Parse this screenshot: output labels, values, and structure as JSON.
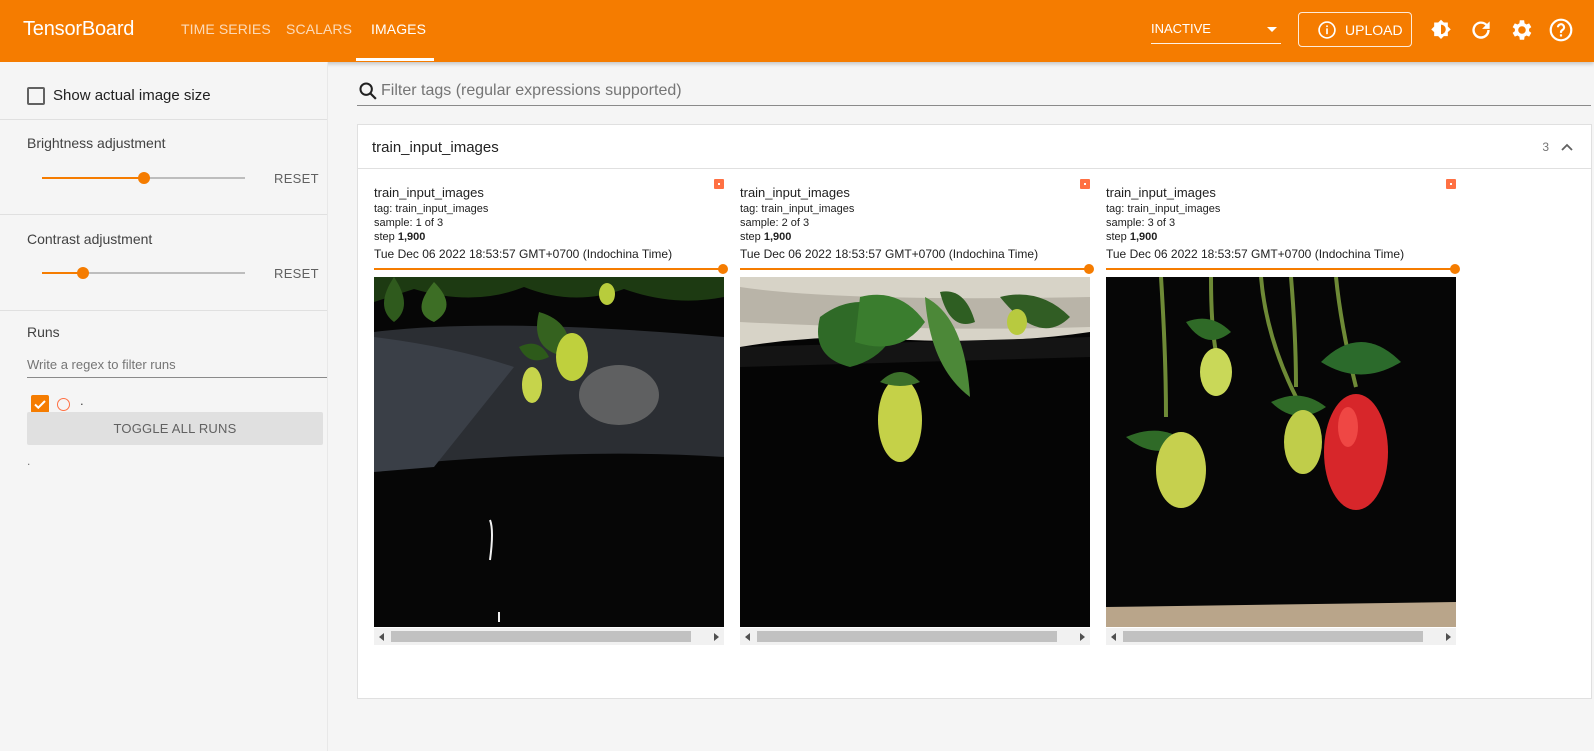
{
  "app": {
    "title": "TensorBoard"
  },
  "nav": {
    "tabs": [
      {
        "label": "TIME SERIES",
        "active": false
      },
      {
        "label": "SCALARS",
        "active": false
      },
      {
        "label": "IMAGES",
        "active": true
      }
    ]
  },
  "toolbar": {
    "status_select": "INACTIVE",
    "upload_label": "UPLOAD",
    "icons": [
      "theme-toggle-icon",
      "refresh-icon",
      "settings-icon",
      "help-icon"
    ]
  },
  "colors": {
    "accent": "#f57c00",
    "menu_badge": "#ff7043"
  },
  "sidebar": {
    "actual_size_label": "Show actual image size",
    "actual_size_checked": false,
    "brightness": {
      "label": "Brightness adjustment",
      "value_fraction": 0.5,
      "reset_label": "RESET"
    },
    "contrast": {
      "label": "Contrast adjustment",
      "value_fraction": 0.2,
      "reset_label": "RESET"
    },
    "runs": {
      "label": "Runs",
      "filter_placeholder": "Write a regex to filter runs",
      "items": [
        {
          "name": ".",
          "checked": true
        }
      ],
      "toggle_label": "TOGGLE ALL RUNS",
      "footer": "."
    }
  },
  "main": {
    "filter_placeholder": "Filter tags (regular expressions supported)",
    "group": {
      "title": "train_input_images",
      "count": "3",
      "cards": [
        {
          "title": "train_input_images",
          "tag_prefix": "tag:",
          "tag": "train_input_images",
          "sample_prefix": "sample:",
          "sample": "1 of 3",
          "step_prefix": "step",
          "step": "1,900",
          "date": "Tue Dec 06 2022 18:53:57 GMT+0700 (Indochina Time)",
          "image": "strawberry-plant-photo"
        },
        {
          "title": "train_input_images",
          "tag_prefix": "tag:",
          "tag": "train_input_images",
          "sample_prefix": "sample:",
          "sample": "2 of 3",
          "step_prefix": "step",
          "step": "1,900",
          "date": "Tue Dec 06 2022 18:53:57 GMT+0700 (Indochina Time)",
          "image": "strawberry-plant-photo"
        },
        {
          "title": "train_input_images",
          "tag_prefix": "tag:",
          "tag": "train_input_images",
          "sample_prefix": "sample:",
          "sample": "3 of 3",
          "step_prefix": "step",
          "step": "1,900",
          "date": "Tue Dec 06 2022 18:53:57 GMT+0700 (Indochina Time)",
          "image": "strawberry-plant-photo"
        }
      ]
    }
  }
}
